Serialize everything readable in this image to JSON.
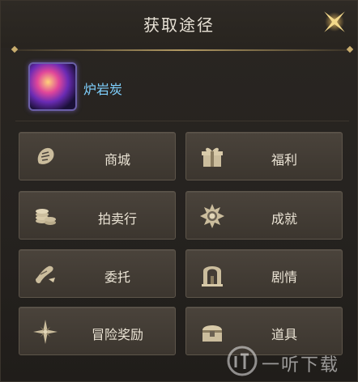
{
  "dialog": {
    "title": "获取途径"
  },
  "item": {
    "name": "炉岩炭",
    "name_color": "#7fd0ff"
  },
  "sources": [
    {
      "label": "商城",
      "icon": "shop-icon"
    },
    {
      "label": "福利",
      "icon": "gift-icon"
    },
    {
      "label": "拍卖行",
      "icon": "coins-icon"
    },
    {
      "label": "成就",
      "icon": "medal-icon"
    },
    {
      "label": "委托",
      "icon": "scroll-icon"
    },
    {
      "label": "剧情",
      "icon": "gate-icon"
    },
    {
      "label": "冒险奖励",
      "icon": "compass-star-icon"
    },
    {
      "label": "道具",
      "icon": "treasure-chest-icon"
    }
  ],
  "watermark": {
    "text": "一听下载"
  },
  "colors": {
    "accent_gold": "#b39a62",
    "button_bg": "#433c35",
    "text": "#ece5d6"
  }
}
